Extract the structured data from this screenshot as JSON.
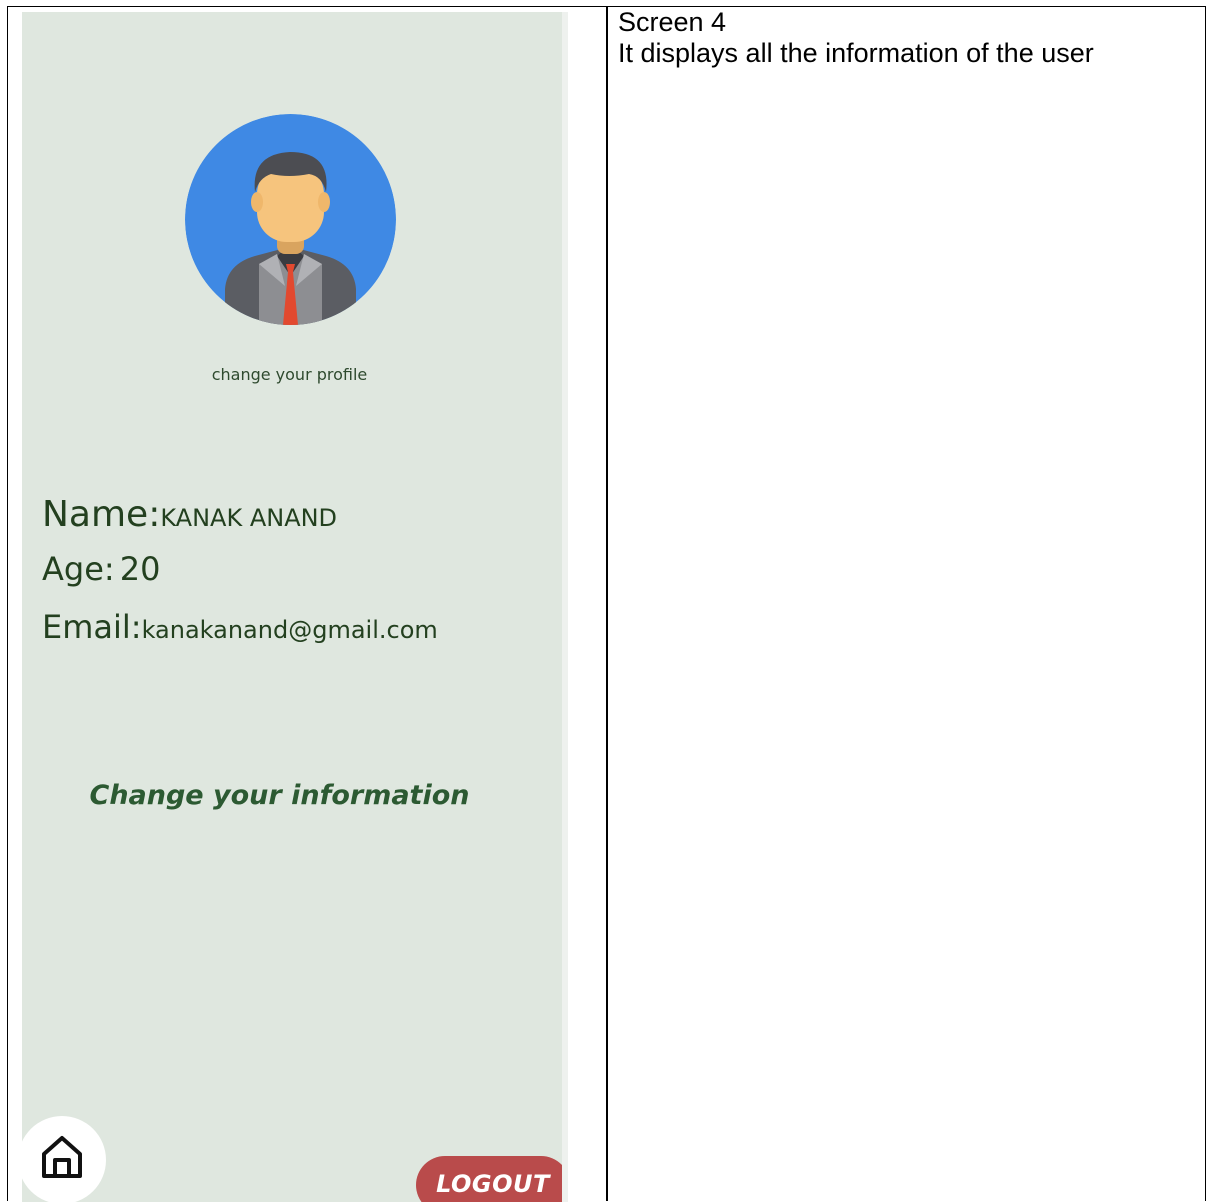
{
  "profile": {
    "avatar_icon": "user-avatar-icon",
    "change_profile_label": "change your profile",
    "name_label": "Name:",
    "name_value": "KANAK ANAND",
    "age_label": "Age:",
    "age_value": "20",
    "email_label": "Email:",
    "email_value": "kanakanand@gmail.com",
    "change_info_label": "Change your information"
  },
  "nav": {
    "home_icon": "home-icon",
    "logout_label": "LOGOUT"
  },
  "description": {
    "title": "Screen 4",
    "text": "It displays all the information of the user"
  },
  "colors": {
    "phone_background": "#dfe7df",
    "text_green": "#23401f",
    "heading_green": "#2c5a32",
    "logout_red": "#b94b4b",
    "avatar_blue": "#3f89e4"
  }
}
